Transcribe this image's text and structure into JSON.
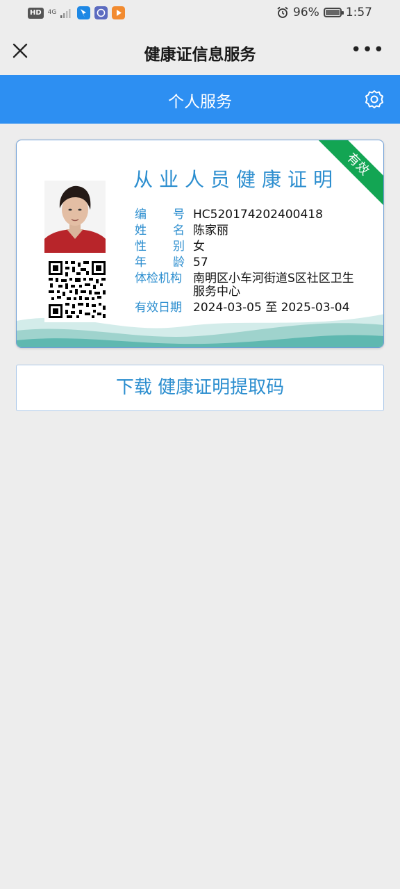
{
  "status_bar": {
    "left_badges": [
      "HD",
      "4G"
    ],
    "battery": "96%",
    "time": "1:57"
  },
  "nav": {
    "title": "健康证信息服务",
    "more": "•••"
  },
  "header": {
    "title": "个人服务"
  },
  "card": {
    "ribbon": "有效",
    "title": "从业人员健康证明",
    "fields": [
      {
        "label_chars": [
          "编",
          "号"
        ],
        "value": "HC520174202400418"
      },
      {
        "label_chars": [
          "姓",
          "名"
        ],
        "value": "陈家丽"
      },
      {
        "label_chars": [
          "性",
          "别"
        ],
        "value": "女"
      },
      {
        "label_chars": [
          "年",
          "龄"
        ],
        "value": "57"
      }
    ],
    "institution_label": "体检机构",
    "institution_value": "南明区小车河街道S区社区卫生服务中心",
    "validity_label": "有效日期",
    "validity_value": "2024-03-05 至 2025-03-04"
  },
  "download_button": "下载 健康证明提取码",
  "colors": {
    "accent_blue": "#2d8ff2",
    "label_blue": "#2c8ecf",
    "ribbon_green": "#13a553",
    "wave_teal": "#5fb8b0"
  }
}
